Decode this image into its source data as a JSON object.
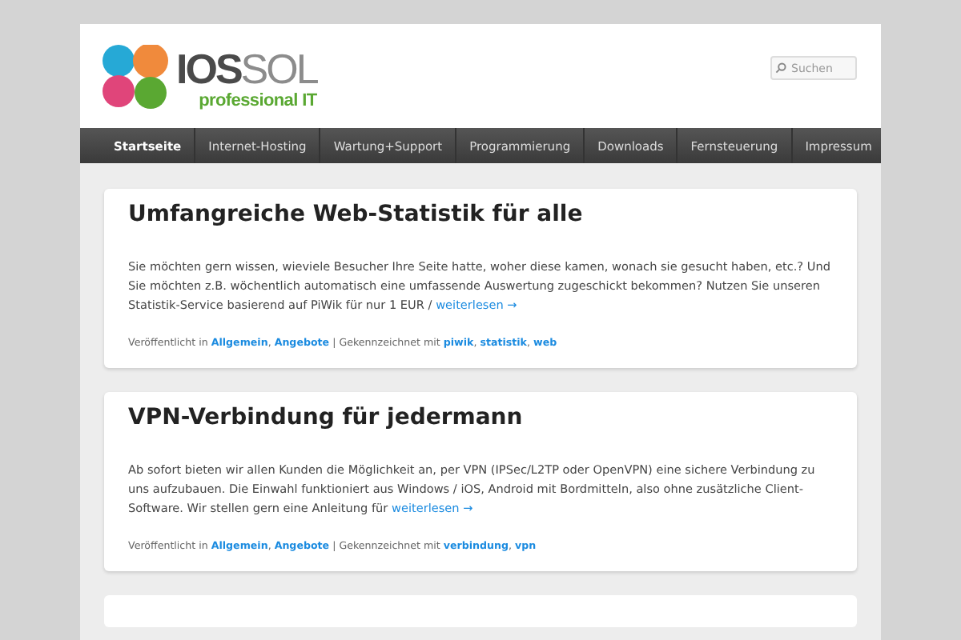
{
  "header": {
    "logo": {
      "name_dark": "IOS",
      "name_light": "SOL",
      "tagline": "professional IT"
    },
    "search": {
      "placeholder": "Suchen"
    }
  },
  "nav": [
    {
      "label": "Startseite",
      "selected": true
    },
    {
      "label": "Internet-Hosting",
      "selected": false
    },
    {
      "label": "Wartung+Support",
      "selected": false
    },
    {
      "label": "Programmierung",
      "selected": false
    },
    {
      "label": "Downloads",
      "selected": false
    },
    {
      "label": "Fernsteuerung",
      "selected": false
    },
    {
      "label": "Impressum",
      "selected": false
    }
  ],
  "posts": [
    {
      "title": "Umfangreiche Web-Statistik für alle",
      "excerpt": "Sie möchten gern wissen, wieviele Besucher Ihre Seite hatte, woher diese kamen, wonach sie gesucht haben, etc.? Und Sie möchten z.B. wöchentlich automatisch eine umfassende Auswertung zugeschickt bekommen? Nutzen Sie unseren Statistik-Service basierend auf PiWik für nur 1 EUR /",
      "more": "weiterlesen →",
      "published_label": "Veröffentlicht in",
      "categories": [
        "Allgemein",
        "Angebote"
      ],
      "list_separator": ",",
      "separator": "|",
      "tagged_label": "Gekennzeichnet mit",
      "tags": [
        "piwik",
        "statistik",
        "web"
      ]
    },
    {
      "title": "VPN-Verbindung für jedermann",
      "excerpt": "Ab sofort bieten wir allen Kunden die Möglichkeit an, per VPN (IPSec/L2TP oder OpenVPN) eine sichere Verbindung zu uns aufzubauen. Die Einwahl funktioniert aus Windows / iOS, Android mit Bordmitteln, also ohne zusätzliche Client-Software. Wir stellen gern eine Anleitung für",
      "more": "weiterlesen →",
      "published_label": "Veröffentlicht in",
      "categories": [
        "Allgemein",
        "Angebote"
      ],
      "list_separator": ",",
      "separator": "|",
      "tagged_label": "Gekennzeichnet mit",
      "tags": [
        "verbindung",
        "vpn"
      ]
    }
  ]
}
